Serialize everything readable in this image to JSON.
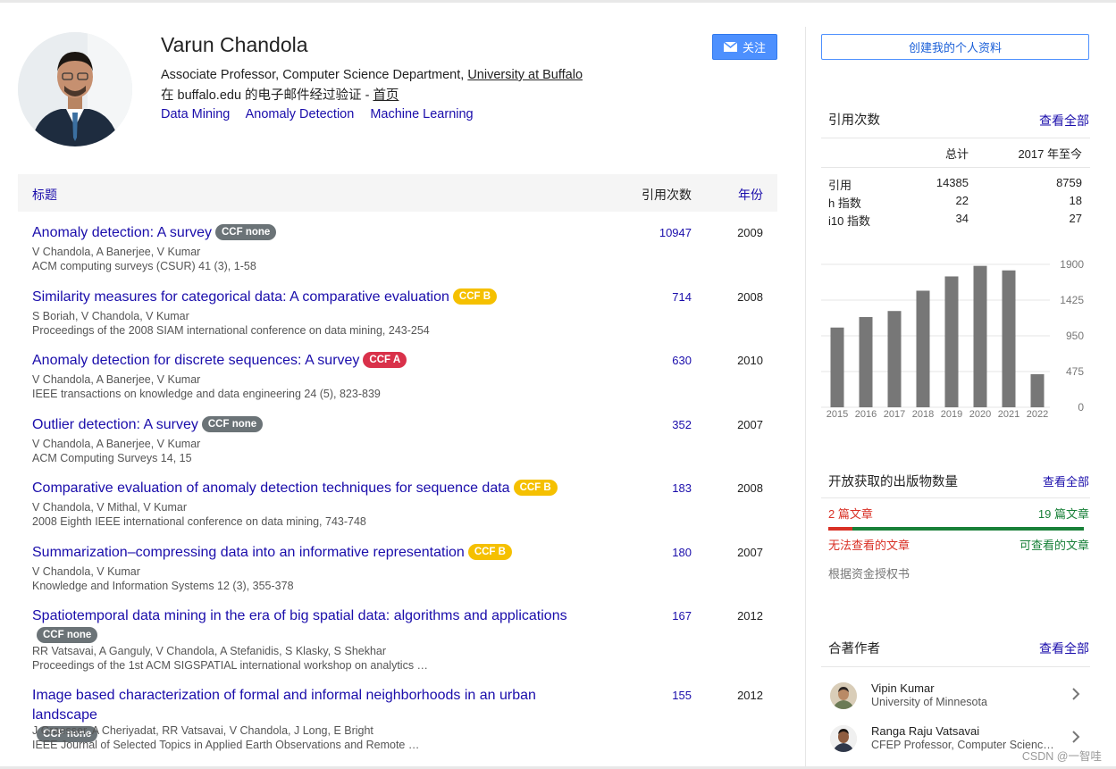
{
  "profile": {
    "name": "Varun Chandola",
    "affiliation": "Associate Professor, Computer Science Department, ",
    "university": "University at Buffalo",
    "verified_prefix": "在 buffalo.edu 的电子邮件经过验证 - ",
    "homepage": "首页",
    "interests": [
      "Data Mining",
      "Anomaly Detection",
      "Machine Learning"
    ],
    "follow_label": "关注"
  },
  "table": {
    "col_title": "标题",
    "col_citations": "引用次数",
    "col_year": "年份"
  },
  "papers": [
    {
      "title": "Anomaly detection: A survey",
      "badge": "CCF none",
      "badge_type": "none",
      "authors": "V Chandola, A Banerjee, V Kumar",
      "venue": "ACM computing surveys (CSUR) 41 (3), 1-58",
      "citations": "10947",
      "year": "2009"
    },
    {
      "title": "Similarity measures for categorical data: A comparative evaluation",
      "badge": "CCF B",
      "badge_type": "b",
      "authors": "S Boriah, V Chandola, V Kumar",
      "venue": "Proceedings of the 2008 SIAM international conference on data mining, 243-254",
      "citations": "714",
      "year": "2008"
    },
    {
      "title": "Anomaly detection for discrete sequences: A survey",
      "badge": "CCF A",
      "badge_type": "a",
      "authors": "V Chandola, A Banerjee, V Kumar",
      "venue": "IEEE transactions on knowledge and data engineering 24 (5), 823-839",
      "citations": "630",
      "year": "2010"
    },
    {
      "title": "Outlier detection: A survey",
      "badge": "CCF none",
      "badge_type": "none",
      "authors": "V Chandola, A Banerjee, V Kumar",
      "venue": "ACM Computing Surveys 14, 15",
      "citations": "352",
      "year": "2007"
    },
    {
      "title": "Comparative evaluation of anomaly detection techniques for sequence data",
      "badge": "CCF B",
      "badge_type": "b",
      "authors": "V Chandola, V Mithal, V Kumar",
      "venue": "2008 Eighth IEEE international conference on data mining, 743-748",
      "citations": "183",
      "year": "2008"
    },
    {
      "title": "Summarization–compressing data into an informative representation",
      "badge": "CCF B",
      "badge_type": "b",
      "authors": "V Chandola, V Kumar",
      "venue": "Knowledge and Information Systems 12 (3), 355-378",
      "citations": "180",
      "year": "2007"
    },
    {
      "title": "Spatiotemporal data mining in the era of big spatial data: algorithms and applications",
      "badge": "CCF none",
      "badge_type": "none",
      "authors": "RR Vatsavai, A Ganguly, V Chandola, A Stefanidis, S Klasky, S Shekhar",
      "venue": "Proceedings of the 1st ACM SIGSPATIAL international workshop on analytics …",
      "citations": "167",
      "year": "2012"
    },
    {
      "title": "Image based characterization of formal and informal neighborhoods in an urban landscape",
      "badge": "CCF none",
      "badge_type": "none",
      "authors": "J Graesser, A Cheriyadat, RR Vatsavai, V Chandola, J Long, E Bright",
      "venue": "IEEE Journal of Selected Topics in Applied Earth Observations and Remote …",
      "citations": "155",
      "year": "2012"
    }
  ],
  "sidebar": {
    "create_profile": "创建我的个人资料",
    "citations_title": "引用次数",
    "view_all": "查看全部",
    "stats_head_total": "总计",
    "stats_head_since": "2017 年至今",
    "stats": [
      {
        "label": "引用",
        "total": "14385",
        "since": "8759"
      },
      {
        "label": "h 指数",
        "total": "22",
        "since": "18"
      },
      {
        "label": "i10 指数",
        "total": "34",
        "since": "27"
      }
    ],
    "oa_title": "开放获取的出版物数量",
    "oa_view_all": "查看全部",
    "oa_unavailable": "2 篇文章",
    "oa_available": "19 篇文章",
    "oa_unavailable_label": "无法查看的文章",
    "oa_available_label": "可查看的文章",
    "oa_unavailable_fraction": 0.095,
    "mandates": "根据资金授权书",
    "coauthors_title": "合著作者",
    "coauthors_view_all": "查看全部",
    "coauthors": [
      {
        "name": "Vipin Kumar",
        "affiliation": "University of Minnesota"
      },
      {
        "name": "Ranga Raju Vatsavai",
        "affiliation": "CFEP Professor, Computer Science, North Carolina State University"
      }
    ]
  },
  "chart_data": {
    "type": "bar",
    "categories": [
      "2015",
      "2016",
      "2017",
      "2018",
      "2019",
      "2020",
      "2021",
      "2022"
    ],
    "values": [
      1060,
      1200,
      1280,
      1550,
      1740,
      1880,
      1820,
      440
    ],
    "yticks": [
      "1900",
      "1425",
      "950",
      "475",
      "0"
    ],
    "ylim": [
      0,
      1900
    ],
    "bar_color": "#777777"
  },
  "watermark": "CSDN @一智哇"
}
